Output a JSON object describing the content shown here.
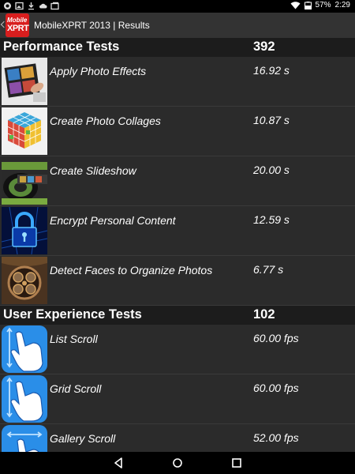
{
  "status_bar": {
    "battery": "57%",
    "time": "2:29"
  },
  "action_bar": {
    "logo_line1": "Mobile",
    "logo_line2": "XPRT",
    "title": "MobileXPRT 2013 | Results"
  },
  "performance": {
    "title": "Performance Tests",
    "score": "392",
    "items": [
      {
        "label": "Apply Photo Effects",
        "value": "16.92 s",
        "icon": "photo-effects-icon"
      },
      {
        "label": "Create Photo Collages",
        "value": "10.87 s",
        "icon": "photo-cube-icon"
      },
      {
        "label": "Create Slideshow",
        "value": "20.00 s",
        "icon": "film-reel-icon"
      },
      {
        "label": "Encrypt Personal Content",
        "value": "12.59 s",
        "icon": "padlock-icon"
      },
      {
        "label": "Detect Faces to Organize Photos",
        "value": "6.77 s",
        "icon": "face-frames-icon"
      }
    ]
  },
  "user_experience": {
    "title": "User Experience Tests",
    "score": "102",
    "items": [
      {
        "label": "List Scroll",
        "value": "60.00 fps",
        "icon": "vertical-scroll-hand-icon"
      },
      {
        "label": "Grid Scroll",
        "value": "60.00 fps",
        "icon": "vertical-scroll-hand-icon"
      },
      {
        "label": "Gallery Scroll",
        "value": "52.00 fps",
        "icon": "horizontal-scroll-hand-icon"
      }
    ]
  },
  "nav": {
    "back": "back-icon",
    "home": "home-icon",
    "recents": "recents-icon"
  }
}
